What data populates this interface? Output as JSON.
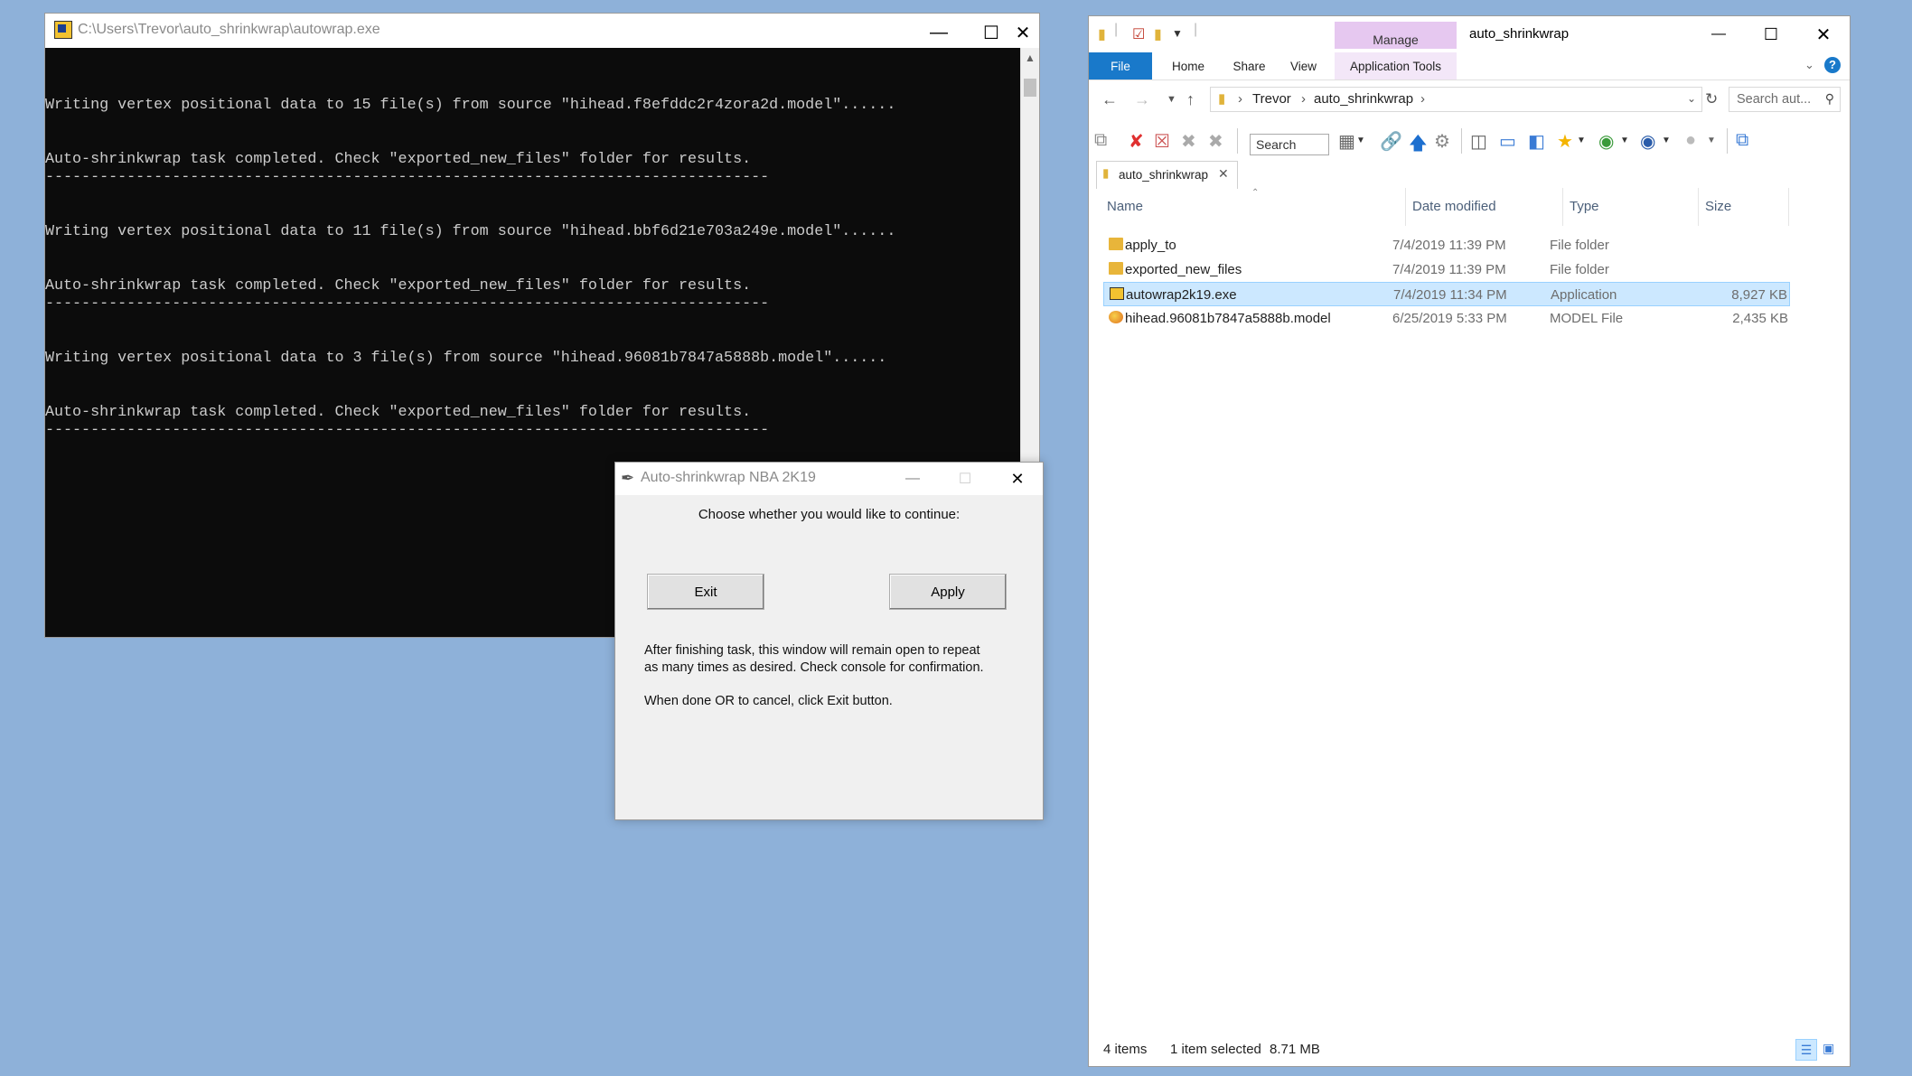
{
  "console": {
    "title": "C:\\Users\\Trevor\\auto_shrinkwrap\\autowrap.exe",
    "lines": [
      "Writing vertex positional data to 15 file(s) from source \"hihead.f8efddc2r4zora2d.model\"......",
      "Auto-shrinkwrap task completed. Check \"exported_new_files\" folder for results.",
      "--------------------------------------------------------------------------------",
      "Writing vertex positional data to 11 file(s) from source \"hihead.bbf6d21e703a249e.model\"......",
      "Auto-shrinkwrap task completed. Check \"exported_new_files\" folder for results.",
      "--------------------------------------------------------------------------------",
      "Writing vertex positional data to 3 file(s) from source \"hihead.96081b7847a5888b.model\"......",
      "Auto-shrinkwrap task completed. Check \"exported_new_files\" folder for results.",
      "--------------------------------------------------------------------------------"
    ]
  },
  "dialog": {
    "title": "Auto-shrinkwrap NBA 2K19",
    "prompt": "Choose whether you would like to continue:",
    "exit_label": "Exit",
    "apply_label": "Apply",
    "info_line1": "After finishing task, this window will remain open to repeat",
    "info_line2": "as many times as desired. Check console for confirmation.",
    "info_line3": "When done OR to cancel, click Exit button."
  },
  "explorer": {
    "title": "auto_shrinkwrap",
    "manage_label": "Manage",
    "ribbon_tabs": {
      "file": "File",
      "home": "Home",
      "share": "Share",
      "view": "View",
      "app_tools": "Application Tools"
    },
    "breadcrumb": {
      "parent": "Trevor",
      "current": "auto_shrinkwrap"
    },
    "search_placeholder": "Search aut...",
    "toolbar_search": "Search",
    "tab_label": "auto_shrinkwrap",
    "columns": {
      "name": "Name",
      "date": "Date modified",
      "type": "Type",
      "size": "Size"
    },
    "files": [
      {
        "name": "apply_to",
        "date": "7/4/2019 11:39 PM",
        "type": "File folder",
        "size": "",
        "icon": "folder-icon"
      },
      {
        "name": "exported_new_files",
        "date": "7/4/2019 11:39 PM",
        "type": "File folder",
        "size": "",
        "icon": "folder-icon"
      },
      {
        "name": "autowrap2k19.exe",
        "date": "7/4/2019 11:34 PM",
        "type": "Application",
        "size": "8,927 KB",
        "icon": "application-icon",
        "selected": true
      },
      {
        "name": "hihead.96081b7847a5888b.model",
        "date": "6/25/2019 5:33 PM",
        "type": "MODEL File",
        "size": "2,435 KB",
        "icon": "model-file-icon"
      }
    ],
    "status": {
      "count": "4 items",
      "selection": "1 item selected",
      "size": "8.71 MB"
    }
  },
  "colors": {
    "desktop": "#8eb1d9",
    "accent": "#1979ca",
    "selection": "#cce8ff",
    "manage": "#e6c8f0"
  }
}
